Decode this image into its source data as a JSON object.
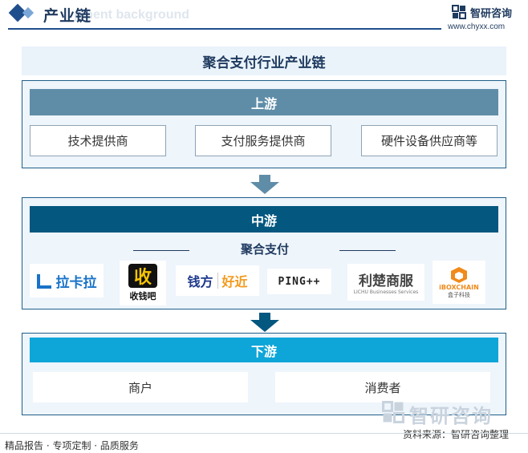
{
  "header": {
    "title": "产业链",
    "bg_text": "pment background",
    "brand_name": "智研咨询",
    "brand_url": "www.chyxx.com",
    "accent": "#1f4e8c"
  },
  "main_title": "聚合支付行业产业链",
  "upstream": {
    "title": "上游",
    "color": "#5f8da8",
    "items": [
      "技术提供商",
      "支付服务提供商",
      "硬件设备供应商等"
    ]
  },
  "midstream": {
    "title": "中游",
    "color": "#04577f",
    "subtitle": "聚合支付",
    "logos": [
      {
        "name": "lakala",
        "text": "拉卡拉"
      },
      {
        "name": "shouqianba",
        "glyph": "收",
        "text": "收钱吧"
      },
      {
        "name": "qianfang-haojin",
        "text_a": "钱方",
        "text_b": "好近"
      },
      {
        "name": "ping-plus-plus",
        "text": "PING++"
      },
      {
        "name": "lichu",
        "text": "利楚商服",
        "sub": "LICHU Businesses Services"
      },
      {
        "name": "iboxchain",
        "text": "iBOXCHAIN",
        "sub": "盒子科技"
      }
    ]
  },
  "downstream": {
    "title": "下游",
    "color": "#0ea5d8",
    "items": [
      "商户",
      "消费者"
    ]
  },
  "footer": {
    "left": "精品报告 · 专项定制 · 品质服务",
    "source": "资料来源：智研咨询整理",
    "watermark": "智研咨询"
  }
}
